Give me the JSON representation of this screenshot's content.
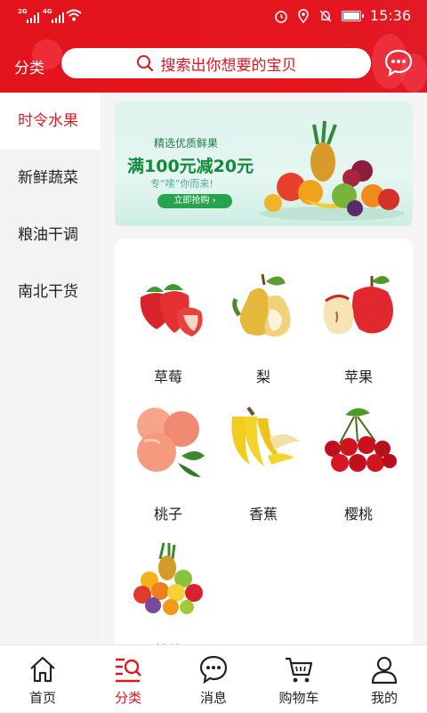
{
  "status_bar": {
    "signal1": "2G",
    "signal2": "4G",
    "time": "15:36"
  },
  "header": {
    "title": "分类",
    "search_placeholder": "搜索出你想要的宝贝",
    "message_icon": "chat-bubble-icon"
  },
  "sidebar": {
    "items": [
      {
        "label": "时令水果",
        "active": true
      },
      {
        "label": "新鲜蔬菜",
        "active": false
      },
      {
        "label": "粮油干调",
        "active": false
      },
      {
        "label": "南北干货",
        "active": false
      }
    ]
  },
  "banner": {
    "subtitle": "精选优质鲜果",
    "headline": "满100元减20元",
    "tagline": "专“嗦”你而来!",
    "button": "立即抢购"
  },
  "products": [
    {
      "name": "草莓",
      "icon": "strawberry-icon"
    },
    {
      "name": "梨",
      "icon": "pear-icon"
    },
    {
      "name": "苹果",
      "icon": "apple-icon"
    },
    {
      "name": "桃子",
      "icon": "peach-icon"
    },
    {
      "name": "香蕉",
      "icon": "banana-icon"
    },
    {
      "name": "樱桃",
      "icon": "cherry-icon"
    },
    {
      "name": "其他",
      "icon": "fruit-basket-icon"
    }
  ],
  "tabbar": {
    "items": [
      {
        "label": "首页",
        "icon": "home-icon",
        "active": false
      },
      {
        "label": "分类",
        "icon": "category-search-icon",
        "active": true
      },
      {
        "label": "消息",
        "icon": "message-icon",
        "active": false
      },
      {
        "label": "购物车",
        "icon": "cart-icon",
        "active": false
      },
      {
        "label": "我的",
        "icon": "user-icon",
        "active": false
      }
    ]
  },
  "colors": {
    "brand_red": "#e3141c",
    "banner_green": "#138a3c",
    "sidebar_bg": "#f3f3f3"
  }
}
